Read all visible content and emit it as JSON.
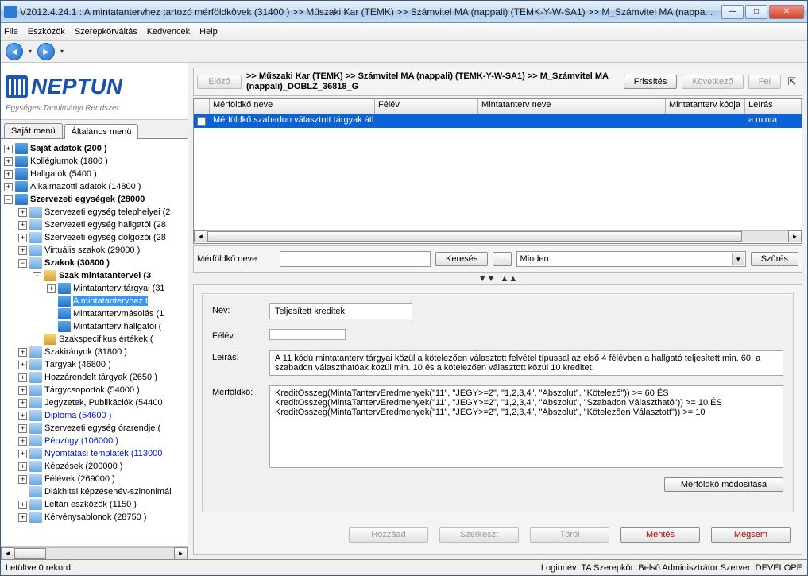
{
  "window": {
    "title": "V2012.4.24.1 : A mintatantervhez tartozó mérföldkövek (31400  )  >> Műszaki Kar (TEMK) >> Számvitel MA (nappali) (TEMK-Y-W-SA1) >> M_Számvitel MA (nappa..."
  },
  "menubar": {
    "file": "File",
    "tools": "Eszközök",
    "role": "Szerepkörváltás",
    "fav": "Kedvencek",
    "help": "Help"
  },
  "logo": {
    "text": "NEPTUN",
    "sub": "Egységes Tanulmányi Rendszer"
  },
  "left_tabs": {
    "own": "Saját menü",
    "general": "Általános menü"
  },
  "tree": {
    "i1": "Saját adatok (200  )",
    "i2": "Kollégiumok (1800  )",
    "i3": "Hallgatók (5400  )",
    "i4": "Alkalmazotti adatok (14800  )",
    "i5": "Szervezeti egységek (28000",
    "i6": "Szervezeti egység telephelyei (2",
    "i7": "Szervezeti egység hallgatói (28",
    "i8": "Szervezeti egység dolgozói (28",
    "i9": "Virtuális szakok (29000  )",
    "i10": "Szakok (30800  )",
    "i11": "Szak mintatantervei (3",
    "i12": "Mintatanterv tárgyai (31",
    "i13": "A mintatantervhez t",
    "i14": "Mintatantervmásolás (1",
    "i15": "Mintatanterv hallgatói (",
    "i16": "Szakspecifikus értékek (",
    "i17": "Szakirányok (31800  )",
    "i18": "Tárgyak (46800  )",
    "i19": "Hozzárendelt tárgyak (2650  )",
    "i20": "Tárgycsoportok (54000  )",
    "i21": "Jegyzetek, Publikációk (54400",
    "i22": "Diploma (54600  )",
    "i23": "Szervezeti egység órarendje (",
    "i24": "Pénzügy (106000  )",
    "i25": "Nyomtatási templatek (113000",
    "i26": "Képzések (200000  )",
    "i27": "Félévek (269000  )",
    "i28": "Diákhitel képzésenév-szinonimál",
    "i29": "Leltári eszközök (1150  )",
    "i30": "Kérvénysablonok (28750  )"
  },
  "top": {
    "prev": "Előző",
    "breadcrumb": ">> Műszaki Kar (TEMK) >> Számvitel MA (nappali) (TEMK-Y-W-SA1) >> M_Számvitel MA (nappali)_DOBLZ_36818_G",
    "refresh": "Frissítés",
    "next": "Következő",
    "up": "Fel"
  },
  "grid": {
    "h1": "Mérföldkő neve",
    "h2": "Félév",
    "h3": "Mintatanterv neve",
    "h4": "Mintatanterv kódja",
    "h5": "Leírás",
    "r1c1": "Mérföldkő szabadon választott tárgyak átla",
    "r1c5": "a minta"
  },
  "search": {
    "label": "Mérföldkő neve",
    "btn": "Keresés",
    "ell": "...",
    "filter_val": "Minden",
    "filter_btn": "Szűrés"
  },
  "form": {
    "name_lbl": "Név:",
    "name_val": "Teljesített kreditek",
    "sem_lbl": "Félév:",
    "sem_val": "",
    "desc_lbl": "Leírás:",
    "desc_val": "A 11 kódú mintatanterv tárgyai közül a kötelezően választott felvétel típussal az első 4 félévben a hallgató teljesített min. 60, a szabadon választhatóak közül min. 10 és a kötelezően választott közül 10 kreditet.",
    "mile_lbl": "Mérföldkő:",
    "mile_val": "  KreditOsszeg(MintaTantervEredmenyek(\"11\", \"JEGY>=2\", \"1,2,3,4\", \"Abszolut\", \"Kötelező\")) >= 60 ÉS  KreditOsszeg(MintaTantervEredmenyek(\"11\", \"JEGY>=2\", \"1,2,3,4\", \"Abszolut\", \"Szabadon Választható\")) >= 10 ÉS  KreditOsszeg(MintaTantervEredmenyek(\"11\", \"JEGY>=2\", \"1,2,3,4\", \"Abszolut\", \"Kötelezően Választott\")) >= 10",
    "modify": "Mérföldkő módosítása"
  },
  "actions": {
    "add": "Hozzáad",
    "edit": "Szerkeszt",
    "del": "Töröl",
    "save": "Mentés",
    "cancel": "Mégsem"
  },
  "status": {
    "left": "Letöltve 0 rekord.",
    "right": "Loginnév: TA    Szerepkör: Belső Adminisztrátor    Szerver: DEVELOPE"
  }
}
